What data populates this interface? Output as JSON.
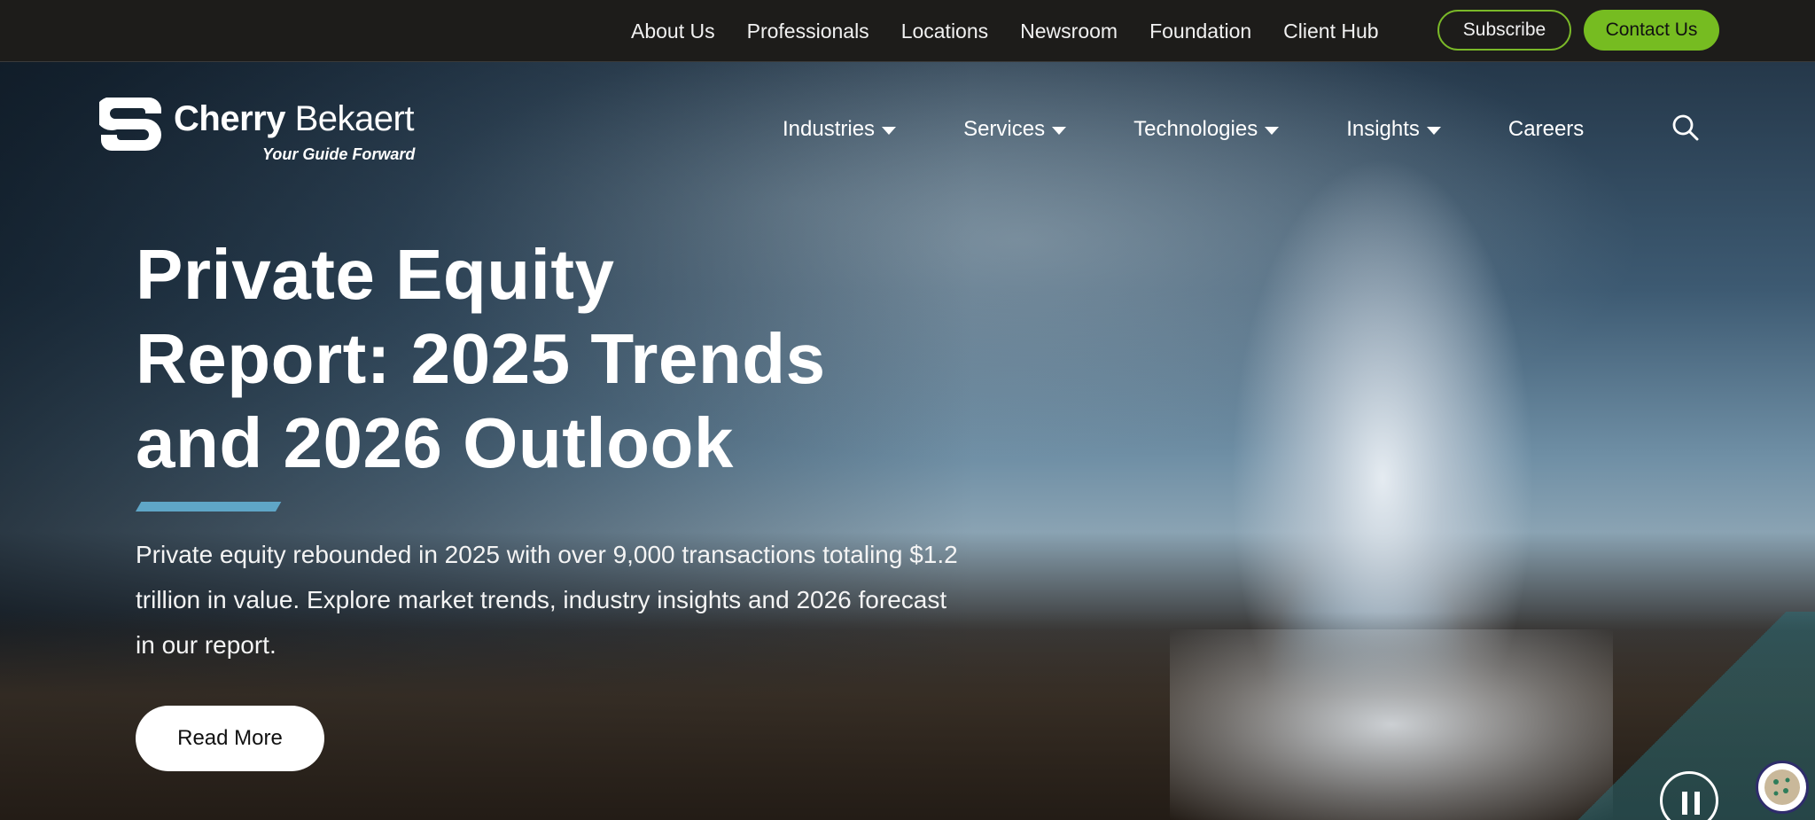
{
  "topbar": {
    "links": [
      "About Us",
      "Professionals",
      "Locations",
      "Newsroom",
      "Foundation",
      "Client Hub"
    ],
    "subscribe_label": "Subscribe",
    "contact_label": "Contact Us",
    "accent_color": "#76bc21"
  },
  "logo": {
    "name_bold": "Cherry",
    "name_light": "Bekaert",
    "tagline": "Your Guide Forward"
  },
  "mainnav": {
    "items": [
      {
        "label": "Industries",
        "has_dropdown": true
      },
      {
        "label": "Services",
        "has_dropdown": true
      },
      {
        "label": "Technologies",
        "has_dropdown": true
      },
      {
        "label": "Insights",
        "has_dropdown": true
      },
      {
        "label": "Careers",
        "has_dropdown": false
      }
    ],
    "search_icon": "search-icon"
  },
  "hero": {
    "title": "Private Equity Report: 2025 Trends and 2026 Outlook",
    "description": "Private equity rebounded in 2025 with over 9,000 transactions totaling $1.2 trillion in value. Explore market trends, industry insights and 2026 forecast in our report.",
    "cta_label": "Read More",
    "accent_color": "#5fa6c7",
    "pause_icon": "pause-icon",
    "cookie_icon": "cookie-icon"
  }
}
